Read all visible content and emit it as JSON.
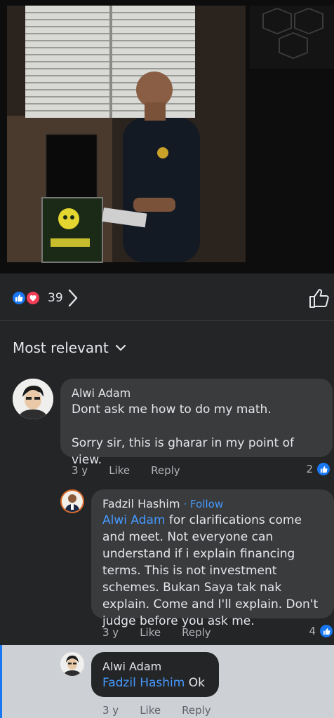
{
  "post": {
    "reactions": {
      "count": "39",
      "types": [
        "like-icon",
        "love-icon"
      ]
    },
    "colors": {
      "accent": "#1877f2",
      "love": "#f33e58",
      "bg": "#242526",
      "bubble": "#3a3b3c",
      "link": "#4599ff"
    }
  },
  "comments_header": {
    "sort_label": "Most relevant"
  },
  "comments": [
    {
      "author": "Alwi Adam",
      "text": "Dont ask me how to do my math.\n\nSorry sir, this is gharar in my point of view.",
      "time": "3 y",
      "like_label": "Like",
      "reply_label": "Reply",
      "reaction_count": "2"
    },
    {
      "author": "Fadzil Hashim",
      "follow_label": "· Follow",
      "mention": "Alwi Adam",
      "text": " for clarifications come and meet. Not everyone can understand if i explain financing terms. This is not investment schemes. Bukan Saya tak nak explain. Come and I'll explain. Don't judge before you ask me.",
      "time": "3 y",
      "like_label": "Like",
      "reply_label": "Reply",
      "reaction_count": "4"
    },
    {
      "author": "Alwi Adam",
      "mention": "Fadzil Hashim",
      "text": " Ok",
      "time": "3 y",
      "like_label": "Like",
      "reply_label": "Reply"
    }
  ]
}
